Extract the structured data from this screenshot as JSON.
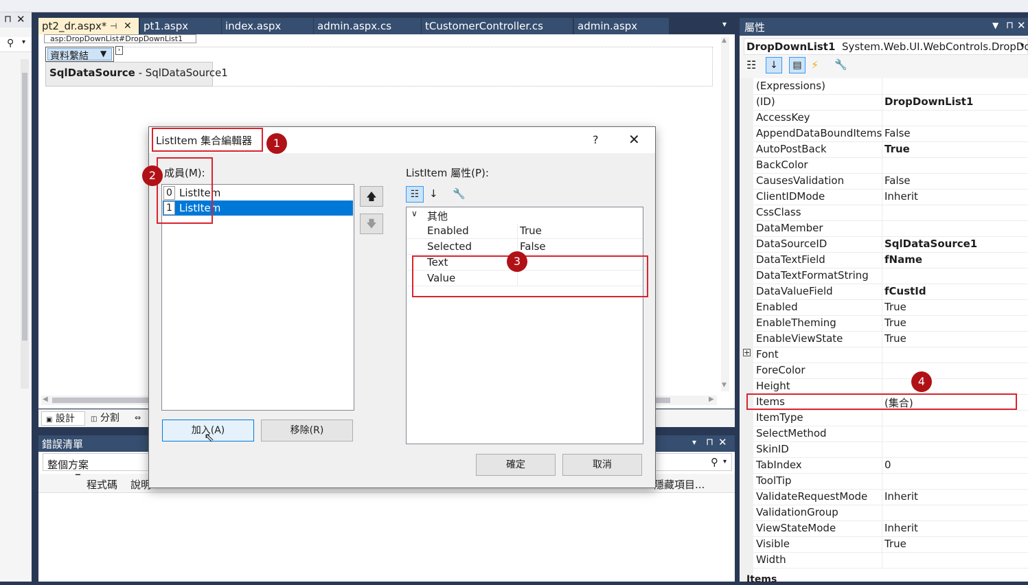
{
  "editor": {
    "tabs": [
      {
        "label": "pt2_dr.aspx*",
        "active": true
      },
      {
        "label": "pt1.aspx",
        "active": false
      },
      {
        "label": "index.aspx",
        "active": false
      },
      {
        "label": "admin.aspx.cs",
        "active": false
      },
      {
        "label": "tCustomerController.cs",
        "active": false
      },
      {
        "label": "admin.aspx",
        "active": false
      }
    ],
    "control_tag": "asp:DropDownList#DropDownList1",
    "dropdown_text": "資料繫結",
    "sqldatasource_label": "SqlDataSource",
    "sqldatasource_name": " - SqlDataSource1",
    "view_tabs": {
      "design": "設計",
      "split": "分割"
    }
  },
  "error_list": {
    "title": "錯誤清單",
    "scope": "整個方案",
    "col_code": "程式碼",
    "col_desc": "說明",
    "suppress": "隱藏項目..."
  },
  "properties_panel": {
    "title": "屬性",
    "object_name": "DropDownList1",
    "object_type": "System.Web.UI.WebControls.DropDowr",
    "rows": [
      {
        "name": "(Expressions)",
        "value": "",
        "bold": false
      },
      {
        "name": "(ID)",
        "value": "DropDownList1",
        "bold": true
      },
      {
        "name": "AccessKey",
        "value": "",
        "bold": false
      },
      {
        "name": "AppendDataBoundItems",
        "value": "False",
        "bold": false
      },
      {
        "name": "AutoPostBack",
        "value": "True",
        "bold": true
      },
      {
        "name": "BackColor",
        "value": "",
        "bold": false
      },
      {
        "name": "CausesValidation",
        "value": "False",
        "bold": false
      },
      {
        "name": "ClientIDMode",
        "value": "Inherit",
        "bold": false
      },
      {
        "name": "CssClass",
        "value": "",
        "bold": false
      },
      {
        "name": "DataMember",
        "value": "",
        "bold": false
      },
      {
        "name": "DataSourceID",
        "value": "SqlDataSource1",
        "bold": true
      },
      {
        "name": "DataTextField",
        "value": "fName",
        "bold": true
      },
      {
        "name": "DataTextFormatString",
        "value": "",
        "bold": false
      },
      {
        "name": "DataValueField",
        "value": "fCustId",
        "bold": true
      },
      {
        "name": "Enabled",
        "value": "True",
        "bold": false
      },
      {
        "name": "EnableTheming",
        "value": "True",
        "bold": false
      },
      {
        "name": "EnableViewState",
        "value": "True",
        "bold": false
      },
      {
        "name": "Font",
        "value": "",
        "bold": false
      },
      {
        "name": "ForeColor",
        "value": "",
        "bold": false
      },
      {
        "name": "Height",
        "value": "",
        "bold": false
      },
      {
        "name": "Items",
        "value": "(集合)",
        "bold": false
      },
      {
        "name": "ItemType",
        "value": "",
        "bold": false
      },
      {
        "name": "SelectMethod",
        "value": "",
        "bold": false
      },
      {
        "name": "SkinID",
        "value": "",
        "bold": false
      },
      {
        "name": "TabIndex",
        "value": "0",
        "bold": false
      },
      {
        "name": "ToolTip",
        "value": "",
        "bold": false
      },
      {
        "name": "ValidateRequestMode",
        "value": "Inherit",
        "bold": false
      },
      {
        "name": "ValidationGroup",
        "value": "",
        "bold": false
      },
      {
        "name": "ViewStateMode",
        "value": "Inherit",
        "bold": false
      },
      {
        "name": "Visible",
        "value": "True",
        "bold": false
      },
      {
        "name": "Width",
        "value": "",
        "bold": false
      }
    ],
    "footer": "Items"
  },
  "dialog": {
    "title": "ListItem 集合編輯器",
    "help": "?",
    "members_label": "成員(M):",
    "members": [
      {
        "index": "0",
        "label": "ListItem",
        "selected": false
      },
      {
        "index": "1",
        "label": "ListItem",
        "selected": true
      }
    ],
    "props_label": "ListItem 屬性(P):",
    "category": "其他",
    "props": [
      {
        "name": "Enabled",
        "value": "True"
      },
      {
        "name": "Selected",
        "value": "False"
      },
      {
        "name": "Text",
        "value": ""
      },
      {
        "name": "Value",
        "value": ""
      }
    ],
    "add_button": "加入(A)",
    "remove_button": "移除(R)",
    "ok_button": "確定",
    "cancel_button": "取消"
  },
  "annotations": [
    "1",
    "2",
    "3",
    "4"
  ],
  "colors": {
    "accent": "#0078d7",
    "annotation": "#d9232e",
    "badge": "#b01117",
    "vs_blue": "#293955"
  }
}
